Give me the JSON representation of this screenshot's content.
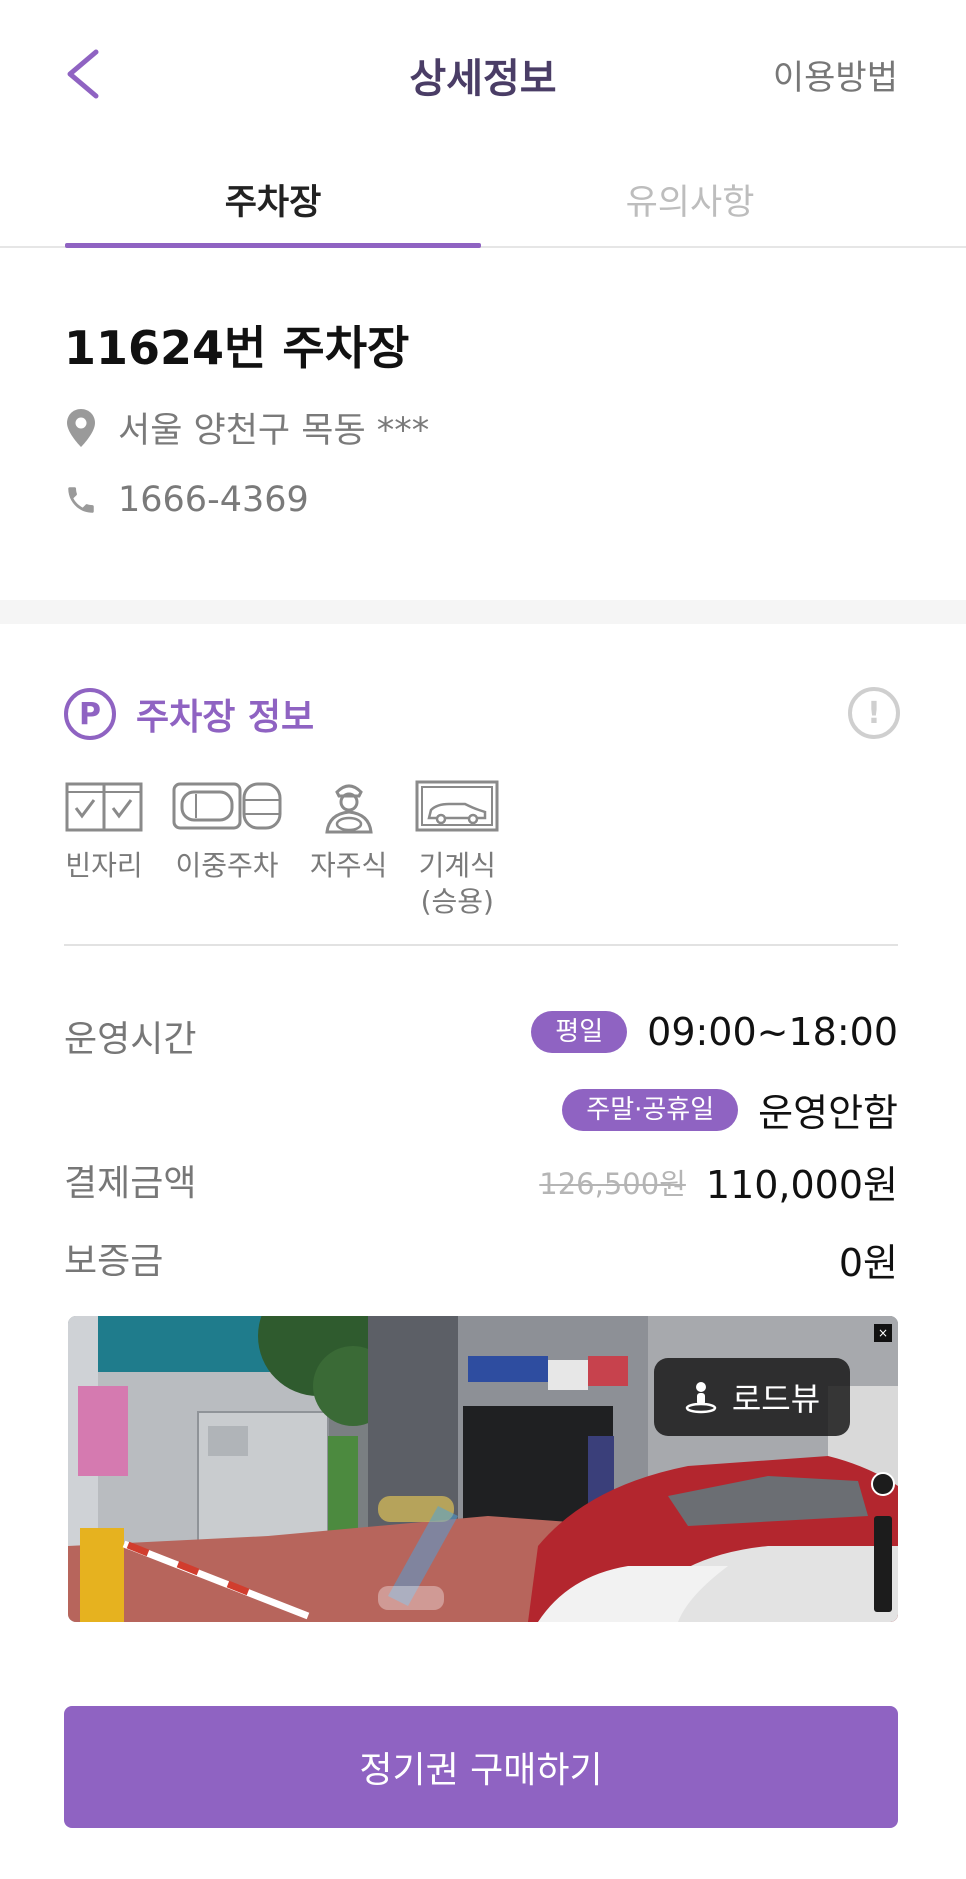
{
  "header": {
    "title": "상세정보",
    "help_link": "이용방법"
  },
  "tabs": [
    {
      "label": "주차장",
      "active": true
    },
    {
      "label": "유의사항",
      "active": false
    }
  ],
  "lot": {
    "name": "11624번 주차장",
    "address": "서울 양천구 목동 ***",
    "phone": "1666-4369"
  },
  "section": {
    "badge": "P",
    "title": "주차장 정보",
    "info_badge": "!",
    "features": [
      {
        "icon": "vacancy-icon",
        "label": "빈자리"
      },
      {
        "icon": "double-parking-icon",
        "label": "이중주차"
      },
      {
        "icon": "self-parking-icon",
        "label": "자주식"
      },
      {
        "icon": "mechanical-parking-icon",
        "label": "기계식\n(승용)"
      }
    ]
  },
  "details": {
    "hours_label": "운영시간",
    "weekday_chip": "평일",
    "weekday_hours": "09:00~18:00",
    "weekend_chip": "주말·공휴일",
    "weekend_hours": "운영안함",
    "price_label": "결제금액",
    "price_original": "126,500원",
    "price_final": "110,000원",
    "deposit_label": "보증금",
    "deposit_value": "0원"
  },
  "roadview": {
    "button_label": "로드뷰",
    "close": "×"
  },
  "purchase_button": "정기권 구매하기",
  "colors": {
    "accent": "#8f63c2",
    "title": "#4a3d66"
  }
}
